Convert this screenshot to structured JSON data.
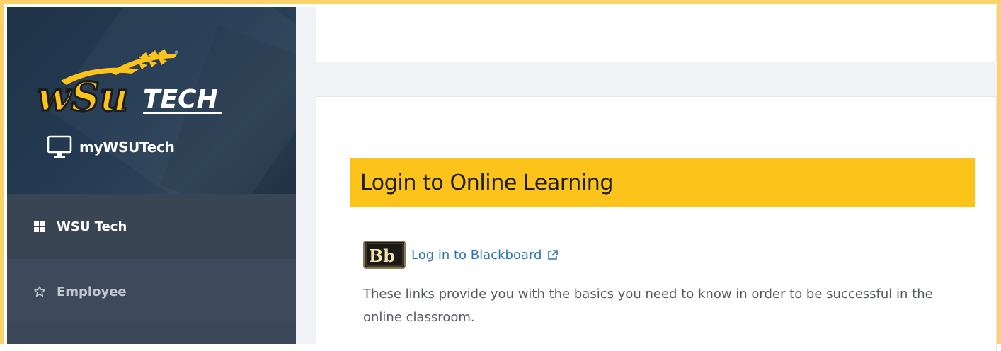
{
  "sidebar": {
    "logo_text": "WSU TECH",
    "app_title": "myWSUTech",
    "items": [
      {
        "label": "WSU Tech",
        "icon": "grid-icon",
        "active": true
      },
      {
        "label": "Employee",
        "icon": "star-icon",
        "active": false
      }
    ]
  },
  "main": {
    "section_title": "Login to Online Learning",
    "blackboard_logo_text": "Bb",
    "blackboard_link": "Log in to Blackboard",
    "description": "These links provide you with the basics you need to know in order to be successful in the online classroom."
  },
  "colors": {
    "accent": "#fcc31a",
    "sidebar": "#3b4656",
    "sidebar_header": "#233a52",
    "link": "#2f73b7"
  }
}
